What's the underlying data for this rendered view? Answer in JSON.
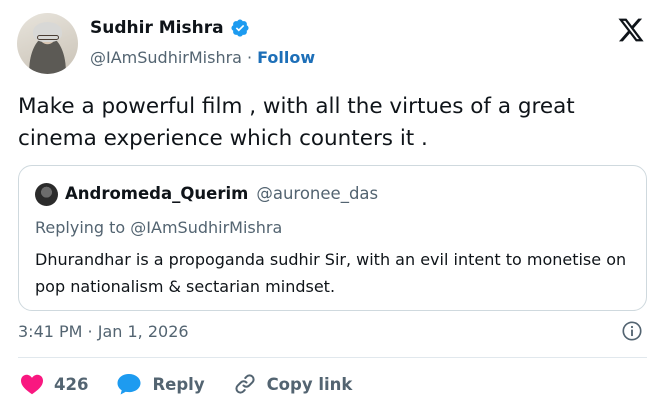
{
  "author": {
    "name": "Sudhir Mishra",
    "handle": "@IAmSudhirMishra",
    "separator": "·",
    "follow_label": "Follow",
    "verified_icon": "verified-badge-icon"
  },
  "brand_icon": "x-logo-icon",
  "tweet_text": "Make a powerful film , with all the virtues of a great cinema experience which counters it .",
  "quoted": {
    "name": "Andromeda_Querim",
    "handle": "@auronee_das",
    "replying_to": "Replying to @IAmSudhirMishra",
    "text": "Dhurandhar is a propoganda sudhir Sir, with an evil intent to monetise on pop nationalism & sectarian mindset."
  },
  "timestamp": "3:41 PM · Jan 1, 2026",
  "actions": {
    "like_count": "426",
    "reply_label": "Reply",
    "copy_link_label": "Copy link"
  },
  "colors": {
    "like": "#f91880",
    "reply": "#1d9bf0",
    "link": "#1d6fb8",
    "verified": "#1d9bf0"
  }
}
